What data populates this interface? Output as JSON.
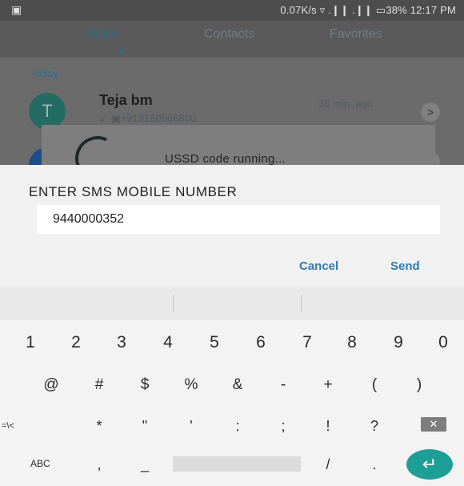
{
  "status_bar": {
    "left_icon": "▣",
    "text": "0.07K/s ▿ .❙❙ .❙❙ ▭38% 12:17 PM"
  },
  "tabs": [
    {
      "label": "Dialer"
    },
    {
      "label": "Contacts"
    },
    {
      "label": "Favorites"
    }
  ],
  "call_log": {
    "section": "Today",
    "entries": [
      {
        "initial": "T",
        "name": "Teja bm",
        "number": "↙ ▣+919160566800",
        "time": "38 min. ago"
      }
    ]
  },
  "ussd": {
    "text": "USSD code running..."
  },
  "dialog": {
    "title": "ENTER SMS MOBILE NUMBER",
    "input_value": "9440000352",
    "cancel_label": "Cancel",
    "send_label": "Send"
  },
  "keyboard": {
    "numbers": [
      "1",
      "2",
      "3",
      "4",
      "5",
      "6",
      "7",
      "8",
      "9",
      "0"
    ],
    "symbols": [
      "@",
      "#",
      "$",
      "%",
      "&",
      "-",
      "+",
      "(",
      ")"
    ],
    "row3": [
      "=\\<",
      "*",
      "\"",
      "'",
      ":",
      ";",
      "!",
      "?"
    ],
    "row4": {
      "abc": "ABC",
      "comma": ",",
      "underscore": "_",
      "slash": "/",
      "period": "."
    },
    "enter_glyph": "↵",
    "backspace_glyph": "✕"
  },
  "colors": {
    "accent": "#2d7bb3",
    "enter_key": "#1e9e96"
  }
}
